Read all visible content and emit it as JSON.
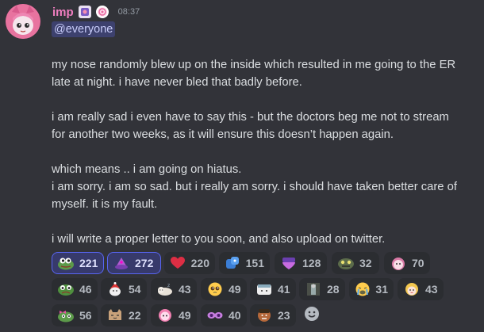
{
  "message": {
    "author": "imp",
    "timestamp": "08:37",
    "mention": "@everyone",
    "lines": [
      "my nose randomly blew up on the inside which resulted in me going to the ER",
      "late at night. i have never bled that badly before.",
      "i am really sad i even have to say this - but the doctors beg me not to stream",
      "for another two weeks, as it will ensure this doesn’t happen again.",
      "which means .. i am going on hiatus.",
      "i am sorry. i am so sad. but i really am sorry. i should have taken better care of",
      "myself. it is my fault.",
      "i will write a proper letter to you soon, and also upload on twitter."
    ]
  },
  "reactions": [
    {
      "icon": "pepe-frog-icon",
      "count": "221",
      "reacted": true
    },
    {
      "icon": "pink-hat-icon",
      "count": "272",
      "reacted": true
    },
    {
      "icon": "red-heart-icon",
      "count": "220",
      "reacted": false
    },
    {
      "icon": "blue-sticker-icon",
      "count": "151",
      "reacted": false
    },
    {
      "icon": "purple-heart-icon",
      "count": "128",
      "reacted": false
    },
    {
      "icon": "green-monster-icon",
      "count": "32",
      "reacted": false
    },
    {
      "icon": "anime-girl-icon",
      "count": "70",
      "reacted": false
    },
    {
      "icon": "pepe-sad-icon",
      "count": "46",
      "reacted": false
    },
    {
      "icon": "santa-cat-icon",
      "count": "54",
      "reacted": false
    },
    {
      "icon": "sleeping-cat-icon",
      "count": "43",
      "reacted": false
    },
    {
      "icon": "pleading-face-icon",
      "count": "49",
      "reacted": false
    },
    {
      "icon": "doctor-cat-icon",
      "count": "41",
      "reacted": false
    },
    {
      "icon": "grey-figure-icon",
      "count": "28",
      "reacted": false
    },
    {
      "icon": "crying-face-icon",
      "count": "31",
      "reacted": false
    },
    {
      "icon": "blonde-girl-icon",
      "count": "43",
      "reacted": false
    },
    {
      "icon": "pepe-bow-icon",
      "count": "56",
      "reacted": false
    },
    {
      "icon": "cat-face-icon",
      "count": "22",
      "reacted": false
    },
    {
      "icon": "pink-character-icon",
      "count": "49",
      "reacted": false
    },
    {
      "icon": "purple-eyes-icon",
      "count": "40",
      "reacted": false
    },
    {
      "icon": "man-face-icon",
      "count": "23",
      "reacted": false
    }
  ],
  "add_reaction_icon": "smiley-add-reaction-icon",
  "colors": {
    "background": "#323339",
    "username": "#ef7ec0",
    "mention_bg": "#3d416e",
    "reacted_border": "#5865f2"
  }
}
